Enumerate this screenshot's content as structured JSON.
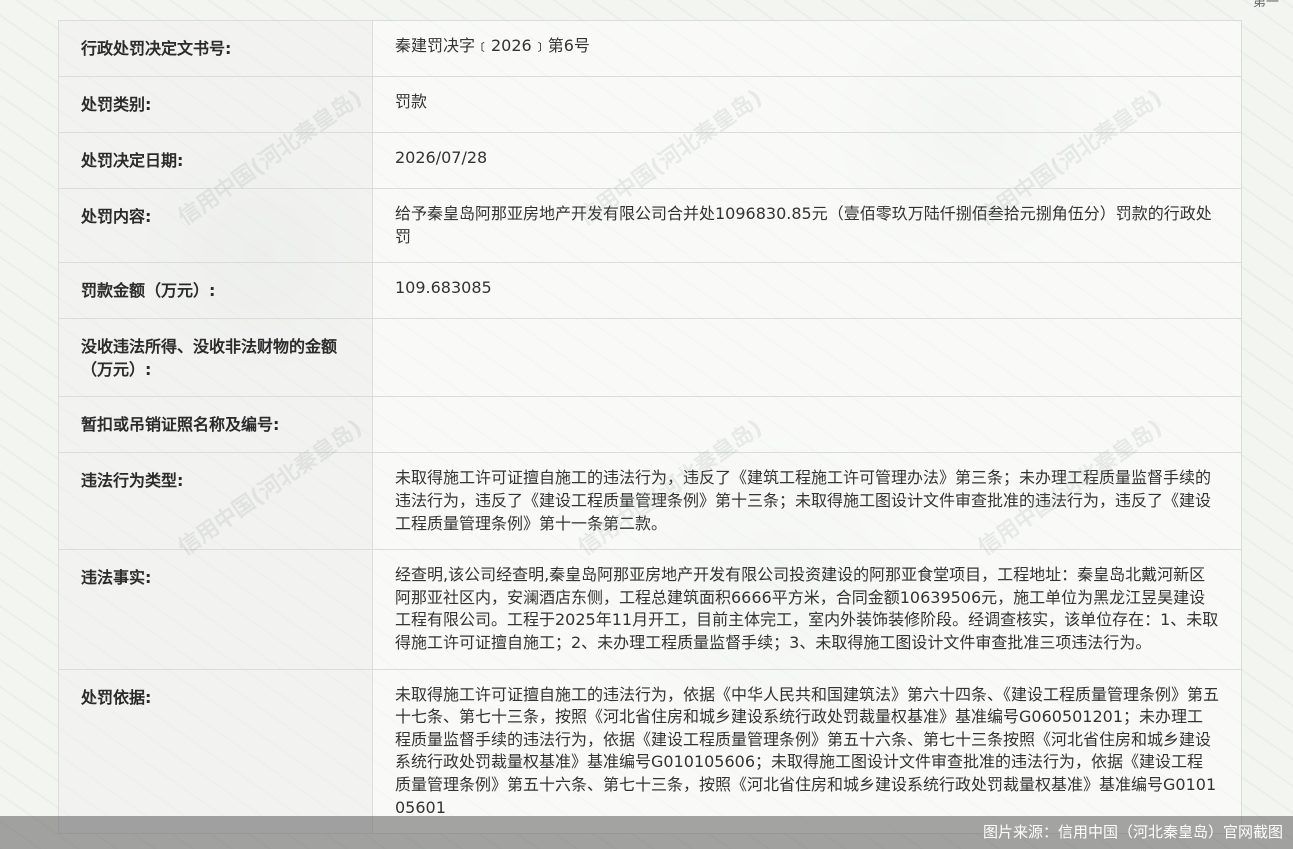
{
  "top_corner_text": "第一",
  "rows": [
    {
      "label": "行政处罚决定文书号:",
      "value": "秦建罚决字﹝2026﹞第6号"
    },
    {
      "label": "处罚类别:",
      "value": "罚款"
    },
    {
      "label": "处罚决定日期:",
      "value": "2026/07/28"
    },
    {
      "label": "处罚内容:",
      "value": "给予秦皇岛阿那亚房地产开发有限公司合并处1096830.85元（壹佰零玖万陆仟捌佰叁拾元捌角伍分）罚款的行政处罚"
    },
    {
      "label": "罚款金额（万元）:",
      "value": "109.683085"
    },
    {
      "label": "没收违法所得、没收非法财物的金额（万元）:",
      "value": ""
    },
    {
      "label": "暂扣或吊销证照名称及编号:",
      "value": ""
    },
    {
      "label": "违法行为类型:",
      "value": "未取得施工许可证擅自施工的违法行为，违反了《建筑工程施工许可管理办法》第三条；未办理工程质量监督手续的违法行为，违反了《建设工程质量管理条例》第十三条；未取得施工图设计文件审查批准的违法行为，违反了《建设工程质量管理条例》第十一条第二款。"
    },
    {
      "label": "违法事实:",
      "value": "经查明,该公司经查明,秦皇岛阿那亚房地产开发有限公司投资建设的阿那亚食堂项目，工程地址：秦皇岛北戴河新区阿那亚社区内，安澜酒店东侧，工程总建筑面积6666平方米，合同金额10639506元，施工单位为黑龙江昱昊建设工程有限公司。工程于2025年11月开工，目前主体完工，室内外装饰装修阶段。经调查核实，该单位存在：1、未取得施工许可证擅自施工；2、未办理工程质量监督手续；3、未取得施工图设计文件审查批准三项违法行为。"
    },
    {
      "label": "处罚依据:",
      "value": "未取得施工许可证擅自施工的违法行为，依据《中华人民共和国建筑法》第六十四条、《建设工程质量管理条例》第五十七条、第七十三条，按照《河北省住房和城乡建设系统行政处罚裁量权基准》基准编号G060501201；未办理工程质量监督手续的违法行为，依据《建设工程质量管理条例》第五十六条、第七十三条按照《河北省住房和城乡建设系统行政处罚裁量权基准》基准编号G010105606；未取得施工图设计文件审查批准的违法行为，依据《建设工程质量管理条例》第五十六条、第七十三条，按照《河北省住房和城乡建设系统行政处罚裁量权基准》基准编号G010105601"
    }
  ],
  "watermark_text": "信用中国(河北秦皇岛)",
  "caption": "图片来源：信用中国（河北秦皇岛）官网截图"
}
